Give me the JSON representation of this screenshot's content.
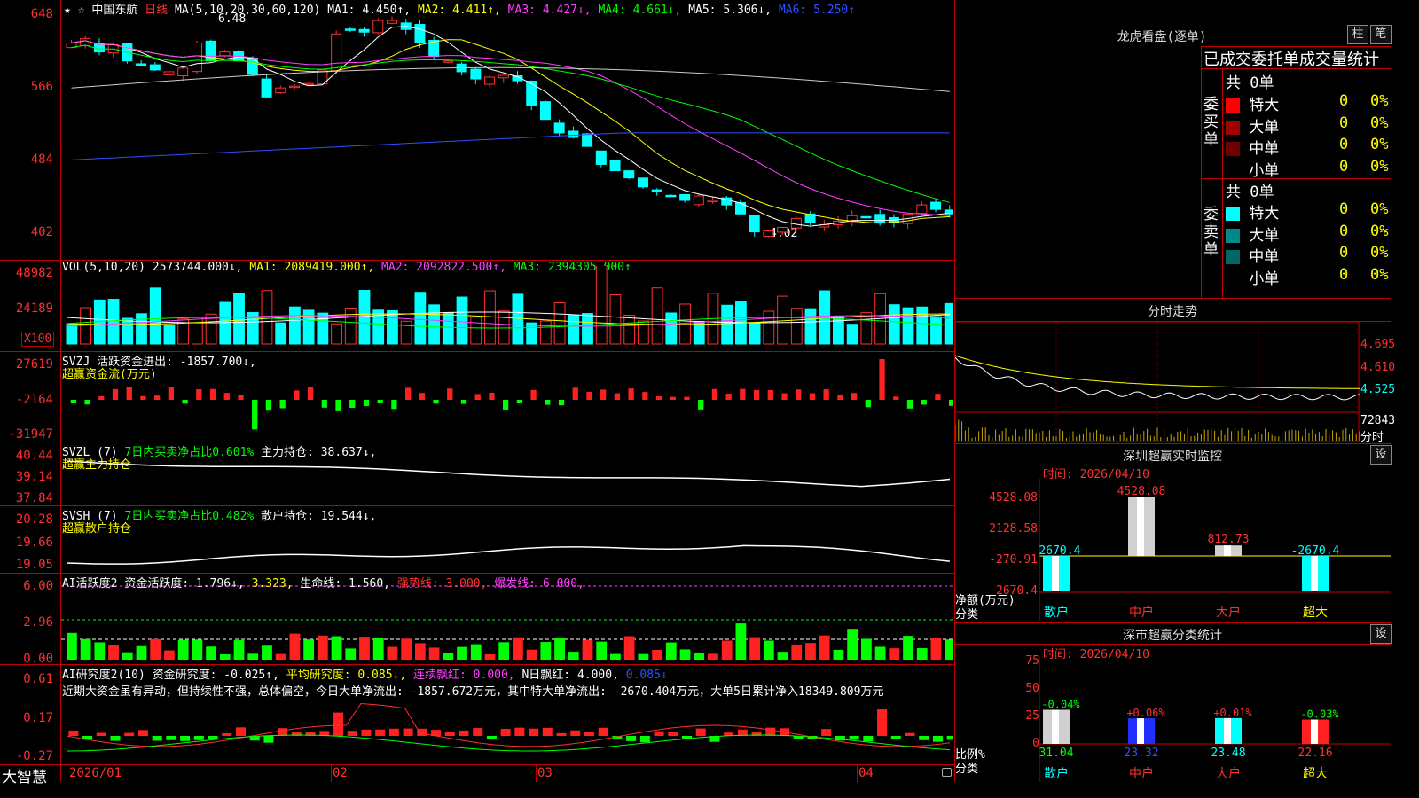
{
  "main": {
    "star_label": "★ ☆",
    "stock_name": "中国东航",
    "period": "日线",
    "ma_title": "MA(5,10,20,30,60,120)",
    "ma1": "MA1: 4.450↑,",
    "ma2": "MA2: 4.411↑,",
    "ma3": "MA3: 4.427↓,",
    "ma4": "MA4: 4.661↓,",
    "ma5": "MA5: 5.306↓,",
    "ma6": "MA6: 5.250↑",
    "high_mark": "6.48",
    "low_mark": "4.02",
    "y_labels": [
      "648",
      "566",
      "484",
      "402"
    ]
  },
  "vol": {
    "title": "VOL(5,10,20)",
    "value": "2573744.000↓,",
    "ma1": "MA1: 2089419.000↑,",
    "ma2": "MA2: 2092822.500↑,",
    "ma3": "MA3: 2394305.000↑",
    "y_labels": [
      "48982",
      "24189"
    ],
    "unit": "X100"
  },
  "svzj": {
    "title": "SVZJ",
    "line1": "活跃资金进出: -1857.700↓,",
    "line2": "超赢资金流(万元)",
    "y_labels": [
      "27619",
      "-2164",
      "-31947"
    ]
  },
  "svzl": {
    "title": "SVZL (7)",
    "ratio": "7日内买卖净占比0.601%",
    "hold": "主力持仓: 38.637↓,",
    "name": "超赢主力持仓",
    "y_labels": [
      "40.44",
      "39.14",
      "37.84"
    ]
  },
  "svsh": {
    "title": "SVSH (7)",
    "ratio": "7日内买卖净占比0.482%",
    "hold": "散户持仓: 19.544↓,",
    "name": "超赢散户持仓",
    "y_labels": [
      "20.28",
      "19.66",
      "19.05"
    ]
  },
  "ai1": {
    "title": "AI活跃度2",
    "a": "资金活跃度: 1.796↓,",
    "b": "3.323,",
    "c": "生命线: 1.560,",
    "d": "强势线: 3.000,",
    "e": "爆发线: 6.000,",
    "y_labels": [
      "6.00",
      "2.96",
      "0.00"
    ]
  },
  "ai2": {
    "title": "AI研究度2(10)",
    "a": "资金研究度: -0.025↑,",
    "b": "平均研究度: 0.085↓,",
    "c": "连续飘红: 0.000,",
    "d": "N日飘红: 4.000,",
    "e": "0.085↓",
    "comment": "近期大资金虽有异动，但持续性不强，总体偏空，今日大单净流出: -1857.672万元，其中特大单净流出: -2670.404万元，大单5日累计净入18349.809万元",
    "y_labels": [
      "0.61",
      "0.17",
      "-0.27"
    ]
  },
  "xaxis": {
    "labels": [
      "2026/01",
      "02",
      "03",
      "04"
    ],
    "brand": "大智慧"
  },
  "lhb": {
    "title": "龙虎看盘(逐单)",
    "btn1": "柱",
    "btn2": "笔",
    "sub": "已成交委托单成交量统计",
    "buy_label": "委买单",
    "sell_label": "委卖单",
    "buy_total": "共 0单",
    "sell_total": "共 0单",
    "buy_rows": [
      {
        "name": "特大",
        "count": "0",
        "pct": "0%",
        "color": "#ff0000"
      },
      {
        "name": "大单",
        "count": "0",
        "pct": "0%",
        "color": "#a00000"
      },
      {
        "name": "中单",
        "count": "0",
        "pct": "0%",
        "color": "#700000"
      },
      {
        "name": "小单",
        "count": "0",
        "pct": "0%",
        "color": "#000000"
      }
    ],
    "sell_rows": [
      {
        "name": "特大",
        "count": "0",
        "pct": "0%",
        "color": "#00ffff"
      },
      {
        "name": "大单",
        "count": "0",
        "pct": "0%",
        "color": "#008888"
      },
      {
        "name": "中单",
        "count": "0",
        "pct": "0%",
        "color": "#006666"
      },
      {
        "name": "小单",
        "count": "0",
        "pct": "0%",
        "color": "#000000"
      }
    ]
  },
  "fenshi": {
    "title": "分时走势",
    "prices": [
      "4.695",
      "4.610",
      "4.525"
    ],
    "vol": "72843",
    "unit": "分时"
  },
  "monitor": {
    "title": "深圳超赢实时监控",
    "btn": "设",
    "time": "时间: 2026/04/10",
    "y_labels": [
      "4528.08",
      "2128.58",
      "-270.91",
      "-2670.4"
    ],
    "bar_values": [
      -2670.4,
      4528.08,
      812.73,
      -2670.4
    ],
    "bar_labels": [
      "-2670.4",
      "4528.08",
      "812.73",
      "-2670.4"
    ],
    "categories": [
      "散户",
      "中户",
      "大户",
      "超大"
    ],
    "axis_note1": "净额(万元)",
    "axis_note2": "分类"
  },
  "classify": {
    "title": "深市超赢分类统计",
    "btn": "设",
    "time": "时间: 2026/04/10",
    "y_labels": [
      "75",
      "50",
      "25",
      "0"
    ],
    "values": [
      31.04,
      23.32,
      23.48,
      22.16
    ],
    "value_labels": [
      "31.04",
      "23.32",
      "23.48",
      "22.16"
    ],
    "change_labels": [
      "-0.04%",
      "+0.06%",
      "+0.01%",
      "-0.03%"
    ],
    "categories": [
      "散户",
      "中户",
      "大户",
      "超大"
    ],
    "axis_note1": "比例%",
    "axis_note2": "分类"
  }
}
